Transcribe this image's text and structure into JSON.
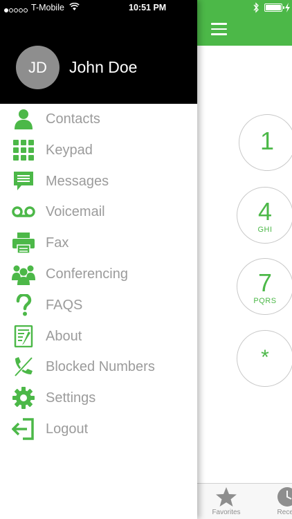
{
  "colors": {
    "accent": "#4cb848",
    "menu_text": "#9b9b9b",
    "header_bg": "#000000"
  },
  "status_bar": {
    "carrier": "T-Mobile",
    "time": "10:51 PM"
  },
  "profile": {
    "initials": "JD",
    "name": "John Doe"
  },
  "menu": {
    "items": [
      {
        "label": "Contacts",
        "icon": "person-icon"
      },
      {
        "label": "Keypad",
        "icon": "keypad-icon"
      },
      {
        "label": "Messages",
        "icon": "message-icon"
      },
      {
        "label": "Voicemail",
        "icon": "voicemail-icon"
      },
      {
        "label": "Fax",
        "icon": "printer-icon"
      },
      {
        "label": "Conferencing",
        "icon": "group-icon"
      },
      {
        "label": "FAQS",
        "icon": "question-icon"
      },
      {
        "label": "About",
        "icon": "document-icon"
      },
      {
        "label": "Blocked Numbers",
        "icon": "blocked-phone-icon"
      },
      {
        "label": "Settings",
        "icon": "gear-icon"
      },
      {
        "label": "Logout",
        "icon": "logout-icon"
      }
    ]
  },
  "dialer": {
    "keys": [
      {
        "digit": "1",
        "letters": ""
      },
      {
        "digit": "4",
        "letters": "GHI"
      },
      {
        "digit": "7",
        "letters": "PQRS"
      },
      {
        "digit": "*",
        "letters": ""
      }
    ]
  },
  "tabbar": {
    "favorites": "Favorites",
    "recents": "Recen"
  }
}
